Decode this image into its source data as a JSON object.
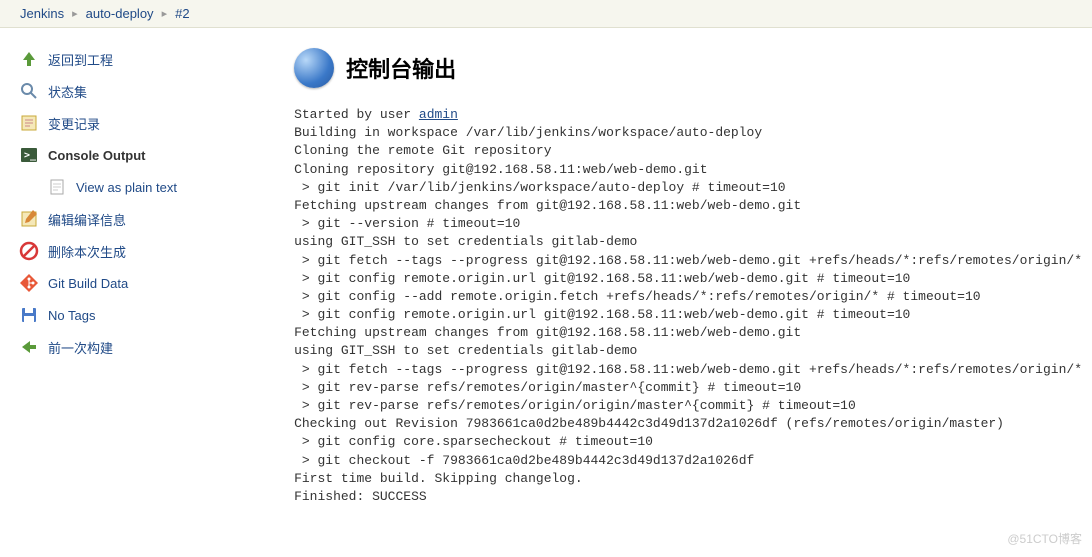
{
  "breadcrumb": {
    "jenkins": "Jenkins",
    "job": "auto-deploy",
    "build": "#2"
  },
  "sidebar": {
    "back": "返回到工程",
    "status": "状态集",
    "changes": "变更记录",
    "console": "Console Output",
    "plaintext": "View as plain text",
    "editbuild": "编辑编译信息",
    "delete": "删除本次生成",
    "gitdata": "Git Build Data",
    "notags": "No Tags",
    "prev": "前一次构建"
  },
  "title": "控制台输出",
  "console": {
    "started_prefix": "Started by user ",
    "started_user": "admin",
    "lines": [
      "Building in workspace /var/lib/jenkins/workspace/auto-deploy",
      "Cloning the remote Git repository",
      "Cloning repository git@192.168.58.11:web/web-demo.git",
      " > git init /var/lib/jenkins/workspace/auto-deploy # timeout=10",
      "Fetching upstream changes from git@192.168.58.11:web/web-demo.git",
      " > git --version # timeout=10",
      "using GIT_SSH to set credentials gitlab-demo",
      " > git fetch --tags --progress git@192.168.58.11:web/web-demo.git +refs/heads/*:refs/remotes/origin/*",
      " > git config remote.origin.url git@192.168.58.11:web/web-demo.git # timeout=10",
      " > git config --add remote.origin.fetch +refs/heads/*:refs/remotes/origin/* # timeout=10",
      " > git config remote.origin.url git@192.168.58.11:web/web-demo.git # timeout=10",
      "Fetching upstream changes from git@192.168.58.11:web/web-demo.git",
      "using GIT_SSH to set credentials gitlab-demo",
      " > git fetch --tags --progress git@192.168.58.11:web/web-demo.git +refs/heads/*:refs/remotes/origin/*",
      " > git rev-parse refs/remotes/origin/master^{commit} # timeout=10",
      " > git rev-parse refs/remotes/origin/origin/master^{commit} # timeout=10",
      "Checking out Revision 7983661ca0d2be489b4442c3d49d137d2a1026df (refs/remotes/origin/master)",
      " > git config core.sparsecheckout # timeout=10",
      " > git checkout -f 7983661ca0d2be489b4442c3d49d137d2a1026df",
      "First time build. Skipping changelog.",
      "Finished: SUCCESS"
    ]
  },
  "watermark": "@51CTO博客"
}
